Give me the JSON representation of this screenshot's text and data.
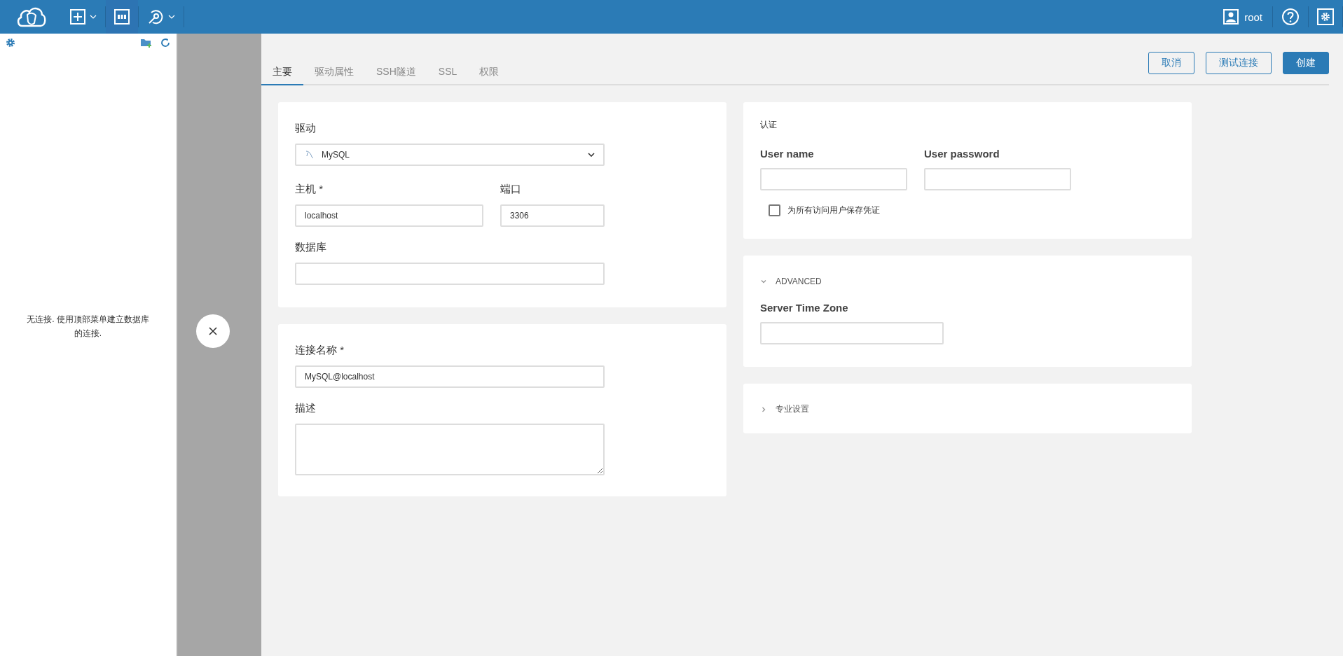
{
  "topbar": {
    "user": "root"
  },
  "sidebar": {
    "empty_message": "无连接. 使用顶部菜单建立数据库的连接."
  },
  "tabs": [
    {
      "label": "主要",
      "selected": true
    },
    {
      "label": "驱动属性",
      "selected": false
    },
    {
      "label": "SSH隧道",
      "selected": false
    },
    {
      "label": "SSL",
      "selected": false
    },
    {
      "label": "权限",
      "selected": false
    }
  ],
  "actions": [
    {
      "label": "取消",
      "kind": "outline"
    },
    {
      "label": "测试连接",
      "kind": "outline"
    },
    {
      "label": "创建",
      "kind": "primary"
    }
  ],
  "connection": {
    "driver_label": "驱动",
    "driver_value": "MySQL",
    "host_label": "主机 *",
    "host_value": "localhost",
    "port_label": "端口",
    "port_value": "3306",
    "database_label": "数据库"
  },
  "naming": {
    "name_label": "连接名称 *",
    "name_value": "MySQL@localhost",
    "description_label": "描述"
  },
  "auth": {
    "title": "认证",
    "username_label": "User name",
    "password_label": "User password",
    "save_label": "为所有访问用户保存凭证",
    "save_checked": false
  },
  "advanced": {
    "title": "ADVANCED",
    "expanded": true,
    "timezone_label": "Server Time Zone"
  },
  "expert": {
    "title": "专业设置",
    "expanded": false
  }
}
